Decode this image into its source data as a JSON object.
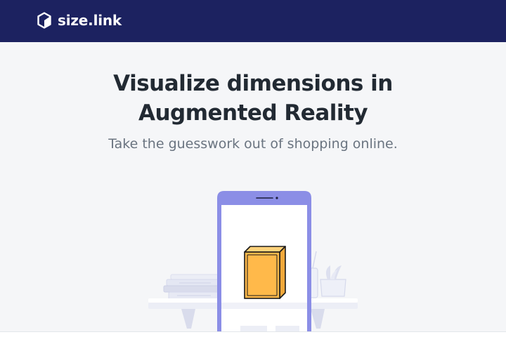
{
  "navbar": {
    "brand_name": "size.link",
    "brand_icon": "cube-logo-icon"
  },
  "hero": {
    "headline": "Visualize dimensions in Augmented Reality",
    "subline": "Take the guesswork out of shopping online."
  },
  "illustration": {
    "phone_color": "#8b8ee6",
    "box_color": "#ffb94a",
    "furniture_color": "#e4e7f3"
  },
  "colors": {
    "navbar_bg": "#1c2260",
    "page_bg": "#f5f6f8",
    "headline_text": "#222a33",
    "subline_text": "#6a7480"
  }
}
